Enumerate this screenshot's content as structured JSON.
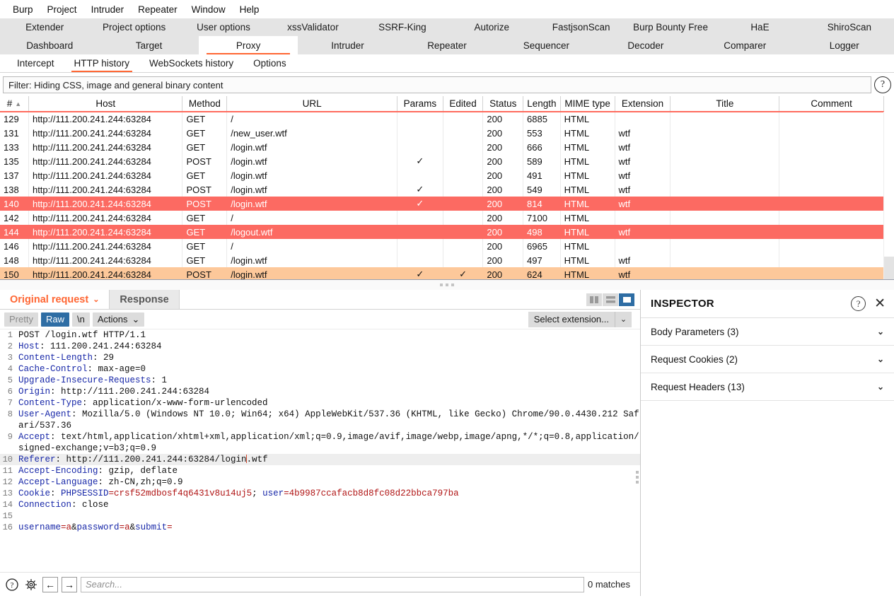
{
  "menubar": [
    "Burp",
    "Project",
    "Intruder",
    "Repeater",
    "Window",
    "Help"
  ],
  "extension_tabs": [
    "Extender",
    "Project options",
    "User options",
    "xssValidator",
    "SSRF-King",
    "Autorize",
    "FastjsonScan",
    "Burp Bounty Free",
    "HaE",
    "ShiroScan"
  ],
  "main_tabs": [
    {
      "label": "Dashboard",
      "active": false
    },
    {
      "label": "Target",
      "active": false
    },
    {
      "label": "Proxy",
      "active": true
    },
    {
      "label": "Intruder",
      "active": false
    },
    {
      "label": "Repeater",
      "active": false
    },
    {
      "label": "Sequencer",
      "active": false
    },
    {
      "label": "Decoder",
      "active": false
    },
    {
      "label": "Comparer",
      "active": false
    },
    {
      "label": "Logger",
      "active": false
    }
  ],
  "sub_tabs": [
    {
      "label": "Intercept",
      "active": false
    },
    {
      "label": "HTTP history",
      "active": true
    },
    {
      "label": "WebSockets history",
      "active": false
    },
    {
      "label": "Options",
      "active": false
    }
  ],
  "filter": {
    "text": "Filter: Hiding CSS, image and general binary content",
    "help_icon": "question-circle-icon"
  },
  "table": {
    "columns": [
      "#",
      "Host",
      "Method",
      "URL",
      "Params",
      "Edited",
      "Status",
      "Length",
      "MIME type",
      "Extension",
      "Title",
      "Comment"
    ],
    "sort_column": "#",
    "sort_arrow": "▲",
    "rows": [
      {
        "id": "129",
        "host": "http://111.200.241.244:63284",
        "method": "GET",
        "url": "/",
        "params": "",
        "edited": "",
        "status": "200",
        "length": "6885",
        "mime": "HTML",
        "ext": "",
        "title": "",
        "comment": "",
        "highlight": "white"
      },
      {
        "id": "131",
        "host": "http://111.200.241.244:63284",
        "method": "GET",
        "url": "/new_user.wtf",
        "params": "",
        "edited": "",
        "status": "200",
        "length": "553",
        "mime": "HTML",
        "ext": "wtf",
        "title": "",
        "comment": "",
        "highlight": "white"
      },
      {
        "id": "133",
        "host": "http://111.200.241.244:63284",
        "method": "GET",
        "url": "/login.wtf",
        "params": "",
        "edited": "",
        "status": "200",
        "length": "666",
        "mime": "HTML",
        "ext": "wtf",
        "title": "",
        "comment": "",
        "highlight": "white"
      },
      {
        "id": "135",
        "host": "http://111.200.241.244:63284",
        "method": "POST",
        "url": "/login.wtf",
        "params": "✓",
        "edited": "",
        "status": "200",
        "length": "589",
        "mime": "HTML",
        "ext": "wtf",
        "title": "",
        "comment": "",
        "highlight": "white"
      },
      {
        "id": "137",
        "host": "http://111.200.241.244:63284",
        "method": "GET",
        "url": "/login.wtf",
        "params": "",
        "edited": "",
        "status": "200",
        "length": "491",
        "mime": "HTML",
        "ext": "wtf",
        "title": "",
        "comment": "",
        "highlight": "white"
      },
      {
        "id": "138",
        "host": "http://111.200.241.244:63284",
        "method": "POST",
        "url": "/login.wtf",
        "params": "✓",
        "edited": "",
        "status": "200",
        "length": "549",
        "mime": "HTML",
        "ext": "wtf",
        "title": "",
        "comment": "",
        "highlight": "white"
      },
      {
        "id": "140",
        "host": "http://111.200.241.244:63284",
        "method": "POST",
        "url": "/login.wtf",
        "params": "✓",
        "edited": "",
        "status": "200",
        "length": "814",
        "mime": "HTML",
        "ext": "wtf",
        "title": "",
        "comment": "",
        "highlight": "red"
      },
      {
        "id": "142",
        "host": "http://111.200.241.244:63284",
        "method": "GET",
        "url": "/",
        "params": "",
        "edited": "",
        "status": "200",
        "length": "7100",
        "mime": "HTML",
        "ext": "",
        "title": "",
        "comment": "",
        "highlight": "white"
      },
      {
        "id": "144",
        "host": "http://111.200.241.244:63284",
        "method": "GET",
        "url": "/logout.wtf",
        "params": "",
        "edited": "",
        "status": "200",
        "length": "498",
        "mime": "HTML",
        "ext": "wtf",
        "title": "",
        "comment": "",
        "highlight": "red"
      },
      {
        "id": "146",
        "host": "http://111.200.241.244:63284",
        "method": "GET",
        "url": "/",
        "params": "",
        "edited": "",
        "status": "200",
        "length": "6965",
        "mime": "HTML",
        "ext": "",
        "title": "",
        "comment": "",
        "highlight": "white"
      },
      {
        "id": "148",
        "host": "http://111.200.241.244:63284",
        "method": "GET",
        "url": "/login.wtf",
        "params": "",
        "edited": "",
        "status": "200",
        "length": "497",
        "mime": "HTML",
        "ext": "wtf",
        "title": "",
        "comment": "",
        "highlight": "white"
      },
      {
        "id": "150",
        "host": "http://111.200.241.244:63284",
        "method": "POST",
        "url": "/login.wtf",
        "params": "✓",
        "edited": "✓",
        "status": "200",
        "length": "624",
        "mime": "HTML",
        "ext": "wtf",
        "title": "",
        "comment": "",
        "highlight": "orange"
      }
    ]
  },
  "message_tabs": [
    {
      "label": "Original request",
      "active": true,
      "has_chevron": true
    },
    {
      "label": "Response",
      "active": false,
      "has_chevron": false
    }
  ],
  "layout_buttons": [
    {
      "name": "layout-side-by-side-icon",
      "selected": false
    },
    {
      "name": "layout-stacked-icon",
      "selected": false
    },
    {
      "name": "layout-single-icon",
      "selected": true
    }
  ],
  "req_toolbar": {
    "pretty": "Pretty",
    "raw": "Raw",
    "newline": "\\n",
    "actions": "Actions",
    "actions_chevron": "⌄",
    "select_extension": "Select extension...",
    "select_extension_chevron": "⌄"
  },
  "request": {
    "lines": [
      {
        "n": "1",
        "highlight": false,
        "parts": [
          {
            "t": "POST /login.wtf HTTP/1.1",
            "c": "v"
          }
        ]
      },
      {
        "n": "2",
        "highlight": false,
        "parts": [
          {
            "t": "Host",
            "c": "k"
          },
          {
            "t": ": 111.200.241.244:63284",
            "c": "v"
          }
        ]
      },
      {
        "n": "3",
        "highlight": false,
        "parts": [
          {
            "t": "Content-Length",
            "c": "k"
          },
          {
            "t": ": 29",
            "c": "v"
          }
        ]
      },
      {
        "n": "4",
        "highlight": false,
        "parts": [
          {
            "t": "Cache-Control",
            "c": "k"
          },
          {
            "t": ": max-age=0",
            "c": "v"
          }
        ]
      },
      {
        "n": "5",
        "highlight": false,
        "parts": [
          {
            "t": "Upgrade-Insecure-Requests",
            "c": "k"
          },
          {
            "t": ": 1",
            "c": "v"
          }
        ]
      },
      {
        "n": "6",
        "highlight": false,
        "parts": [
          {
            "t": "Origin",
            "c": "k"
          },
          {
            "t": ": http://111.200.241.244:63284",
            "c": "v"
          }
        ]
      },
      {
        "n": "7",
        "highlight": false,
        "parts": [
          {
            "t": "Content-Type",
            "c": "k"
          },
          {
            "t": ": application/x-www-form-urlencoded",
            "c": "v"
          }
        ]
      },
      {
        "n": "8",
        "highlight": false,
        "parts": [
          {
            "t": "User-Agent",
            "c": "k"
          },
          {
            "t": ": Mozilla/5.0 (Windows NT 10.0; Win64; x64) AppleWebKit/537.36 (KHTML, like Gecko) Chrome/90.0.4430.212 Safari/537.36",
            "c": "v"
          }
        ]
      },
      {
        "n": "9",
        "highlight": false,
        "parts": [
          {
            "t": "Accept",
            "c": "k"
          },
          {
            "t": ": text/html,application/xhtml+xml,application/xml;q=0.9,image/avif,image/webp,image/apng,*/*;q=0.8,application/signed-exchange;v=b3;q=0.9",
            "c": "v"
          }
        ]
      },
      {
        "n": "10",
        "highlight": true,
        "parts": [
          {
            "t": "Referer",
            "c": "k"
          },
          {
            "t": ": http://111.200.241.244:63284/login",
            "c": "v"
          },
          {
            "t": "",
            "c": "caret"
          },
          {
            "t": ".wtf",
            "c": "v"
          }
        ]
      },
      {
        "n": "11",
        "highlight": false,
        "parts": [
          {
            "t": "Accept-Encoding",
            "c": "k"
          },
          {
            "t": ": gzip, deflate",
            "c": "v"
          }
        ]
      },
      {
        "n": "12",
        "highlight": false,
        "parts": [
          {
            "t": "Accept-Language",
            "c": "k"
          },
          {
            "t": ": zh-CN,zh;q=0.9",
            "c": "v"
          }
        ]
      },
      {
        "n": "13",
        "highlight": false,
        "parts": [
          {
            "t": "Cookie",
            "c": "k"
          },
          {
            "t": ": ",
            "c": "v"
          },
          {
            "t": "PHPSESSID",
            "c": "k"
          },
          {
            "t": "=crsf52mdbosf4q6431v8u14uj5",
            "c": "rv"
          },
          {
            "t": "; ",
            "c": "v"
          },
          {
            "t": "user",
            "c": "k"
          },
          {
            "t": "=4b9987ccafacb8d8fc08d22bbca797ba",
            "c": "rv"
          }
        ]
      },
      {
        "n": "14",
        "highlight": false,
        "parts": [
          {
            "t": "Connection",
            "c": "k"
          },
          {
            "t": ": close",
            "c": "v"
          }
        ]
      },
      {
        "n": "15",
        "highlight": false,
        "parts": [
          {
            "t": "",
            "c": "v"
          }
        ]
      },
      {
        "n": "16",
        "highlight": false,
        "parts": [
          {
            "t": "username",
            "c": "k"
          },
          {
            "t": "=a",
            "c": "rv"
          },
          {
            "t": "&",
            "c": "v"
          },
          {
            "t": "password",
            "c": "k"
          },
          {
            "t": "=a",
            "c": "rv"
          },
          {
            "t": "&",
            "c": "v"
          },
          {
            "t": "submit",
            "c": "k"
          },
          {
            "t": "=",
            "c": "rv"
          }
        ]
      }
    ]
  },
  "searchbar": {
    "help_icon": "question-circle-icon",
    "settings_icon": "gear-icon",
    "prev_icon": "arrow-left-icon",
    "next_icon": "arrow-right-icon",
    "placeholder": "Search...",
    "matches": "0 matches"
  },
  "inspector": {
    "title": "INSPECTOR",
    "help_icon": "question-circle-icon",
    "close_icon": "close-icon",
    "sections": [
      {
        "label": "Body Parameters (3)"
      },
      {
        "label": "Request Cookies (2)"
      },
      {
        "label": "Request Headers (13)"
      }
    ]
  },
  "colors": {
    "accent": "#ff6633",
    "row_red": "#fc6a62",
    "row_orange": "#fdc89a",
    "selected_blue": "#2e6da4"
  }
}
